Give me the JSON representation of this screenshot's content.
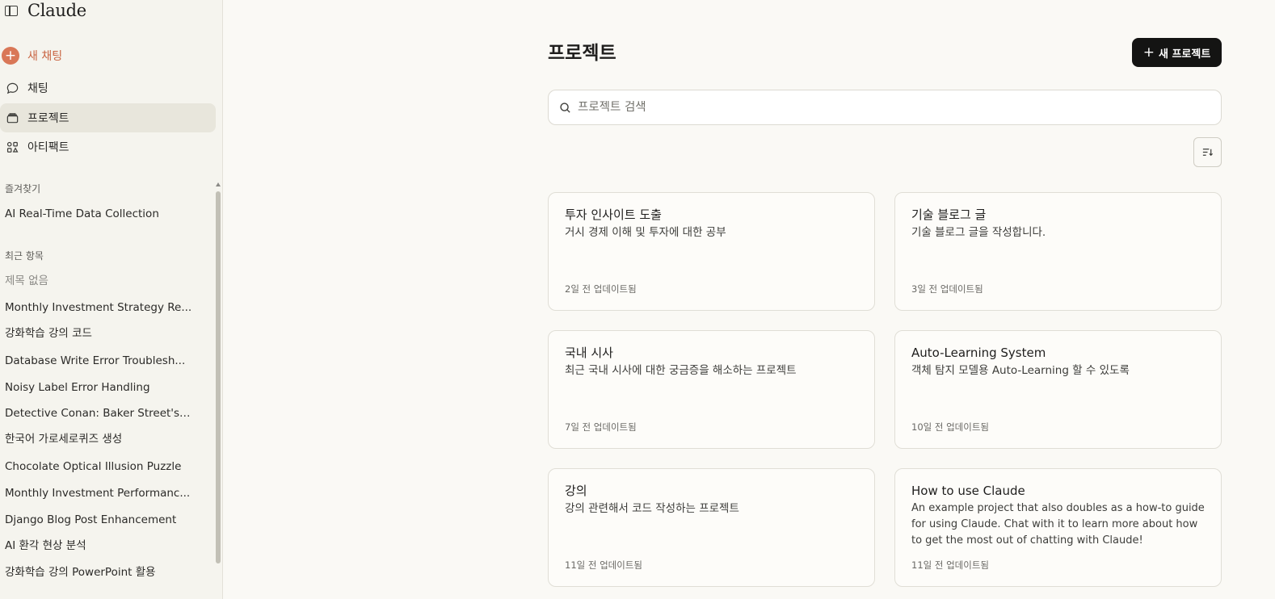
{
  "sidebar": {
    "brand": "Claude",
    "new_chat": "새 채팅",
    "nav": {
      "chats": "채팅",
      "projects": "프로젝트",
      "artifacts": "아티팩트"
    },
    "favorites_title": "즐겨찾기",
    "favorites": [
      "AI Real-Time Data Collection"
    ],
    "recents_title": "최근 항목",
    "recents": [
      "제목 없음",
      "Monthly Investment Strategy Re...",
      "강화학습 강의 코드",
      "Database Write Error Troublesh...",
      "Noisy Label Error Handling",
      "Detective Conan: Baker Street's ...",
      "한국어 가로세로퀴즈 생성",
      "Chocolate Optical Illusion Puzzle",
      "Monthly Investment Performanc...",
      "Django Blog Post Enhancement",
      "AI 환각 현상 분석",
      "강화학습 강의 PowerPoint 활용"
    ]
  },
  "main": {
    "title": "프로젝트",
    "new_project_plus": "+",
    "new_project_label": "새 프로젝트",
    "search_placeholder": "프로젝트 검색",
    "projects": [
      {
        "title": "투자 인사이트 도출",
        "description": "거시 경제 이해 및 투자에 대한 공부",
        "updated": "2일 전 업데이트됨"
      },
      {
        "title": "기술 블로그 글",
        "description": "기술 블로그 글을 작성합니다.",
        "updated": "3일 전 업데이트됨"
      },
      {
        "title": "국내 시사",
        "description": "최근 국내 시사에 대한 궁금증을 해소하는 프로젝트",
        "updated": "7일 전 업데이트됨"
      },
      {
        "title": "Auto-Learning System",
        "description": "객체 탐지 모델용 Auto-Learning 할 수 있도록",
        "updated": "10일 전 업데이트됨"
      },
      {
        "title": "강의",
        "description": "강의 관련해서 코드 작성하는 프로젝트",
        "updated": "11일 전 업데이트됨"
      },
      {
        "title": "How to use Claude",
        "description": "An example project that also doubles as a how-to guide for using Claude. Chat with it to learn more about how to get the most out of chatting with Claude!",
        "updated": "11일 전 업데이트됨"
      }
    ]
  },
  "colors": {
    "accent": "#d97757",
    "accent_text": "#c96442",
    "background": "#faf9f5",
    "sidebar_bg": "#f5f4ee",
    "button_dark": "#141413"
  },
  "icons": {
    "sidebar_toggle": "sidebar-panel-icon",
    "new_chat": "plus-circle-icon",
    "chats": "chat-bubble-icon",
    "projects": "folder-stack-icon",
    "artifacts": "artifacts-grid-icon",
    "search": "search-icon",
    "sort": "sort-icon"
  }
}
